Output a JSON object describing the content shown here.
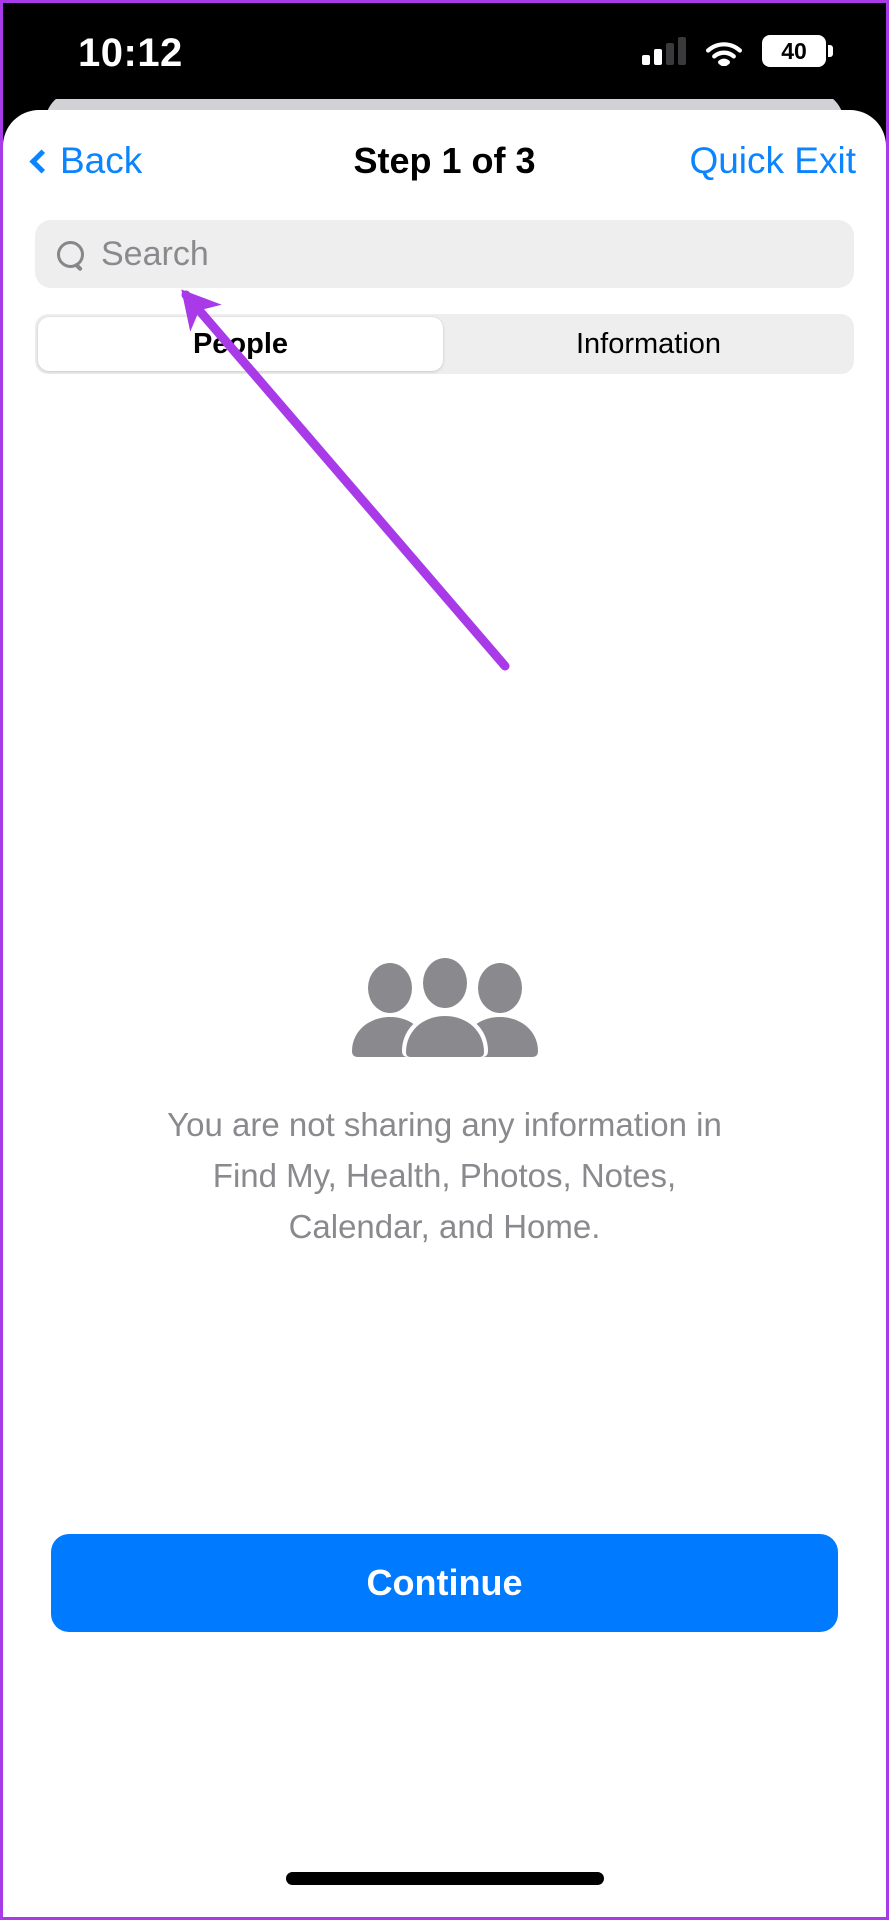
{
  "status_bar": {
    "time": "10:12",
    "signal_icon": "cellular-signal-icon",
    "wifi_icon": "wifi-icon",
    "battery_level": "40"
  },
  "navbar": {
    "back_label": "Back",
    "back_icon": "chevron-left-icon",
    "title": "Step 1 of 3",
    "quick_exit_label": "Quick Exit"
  },
  "search": {
    "icon": "search-icon",
    "placeholder": "Search",
    "value": ""
  },
  "segmented_control": {
    "options": [
      {
        "label": "People",
        "selected": true
      },
      {
        "label": "Information",
        "selected": false
      }
    ]
  },
  "empty_state": {
    "icon": "people-group-icon",
    "message": "You are not sharing any information in Find My, Health, Photos, Notes, Calendar, and Home."
  },
  "footer": {
    "continue_label": "Continue"
  },
  "annotation": {
    "type": "arrow",
    "color": "#a93ae8",
    "points_to": "search-input"
  },
  "colors": {
    "accent_blue": "#007aff",
    "link_blue": "#0a84ff",
    "gray_text": "#8a8a8e",
    "field_gray": "#eeeeef",
    "annotation_purple": "#a93ae8"
  }
}
